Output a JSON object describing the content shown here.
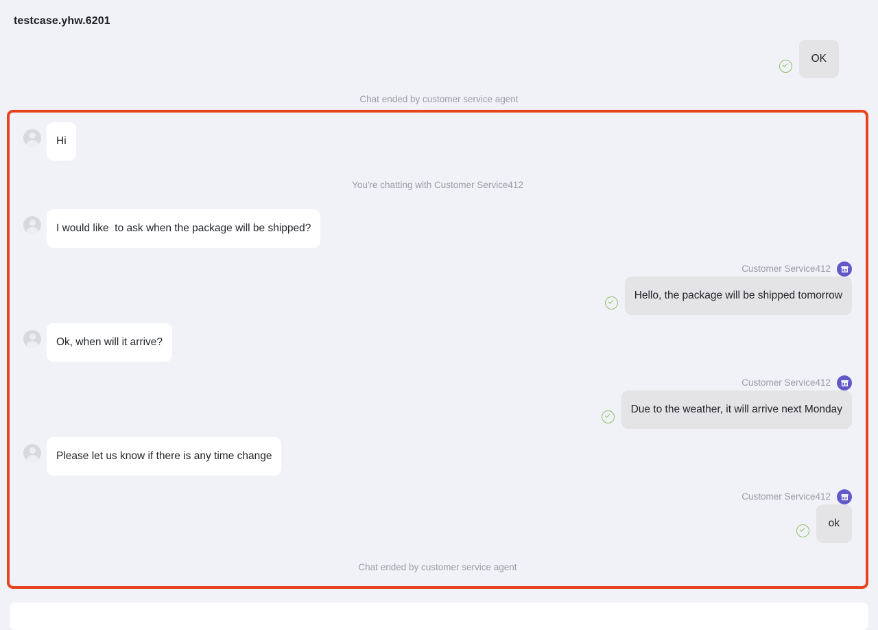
{
  "window": {
    "title": "testcase.yhw.6201"
  },
  "colors": {
    "background": "#f1f2f7",
    "annotation_border": "#e8431f",
    "agent_bubble": "#e4e4e6",
    "user_bubble": "#ffffff",
    "agent_avatar": "#6259c9",
    "check_green": "#8cc063",
    "system_text": "#9b9ba3"
  },
  "top": {
    "outgoing_message": "OK",
    "system_notice": "Chat ended by customer service agent"
  },
  "conversation": {
    "agent_name": "Customer Service412",
    "system_joined": "You're chatting with Customer Service412",
    "system_ended": "Chat ended by customer service agent",
    "messages": [
      {
        "from": "user",
        "text": "Hi"
      },
      {
        "from": "user",
        "text": "I would like  to ask when the package will be shipped?"
      },
      {
        "from": "agent",
        "text": "Hello, the package will be shipped tomorrow"
      },
      {
        "from": "user",
        "text": "Ok, when will it arrive?"
      },
      {
        "from": "agent",
        "text": "Due to the weather, it will arrive next Monday"
      },
      {
        "from": "user",
        "text": "Please let us know if there is any time change"
      },
      {
        "from": "agent",
        "text": "ok"
      }
    ]
  },
  "icons": {
    "user_avatar": "person-avatar-icon",
    "agent_avatar": "storefront-icon",
    "delivered": "check-circle-icon"
  }
}
